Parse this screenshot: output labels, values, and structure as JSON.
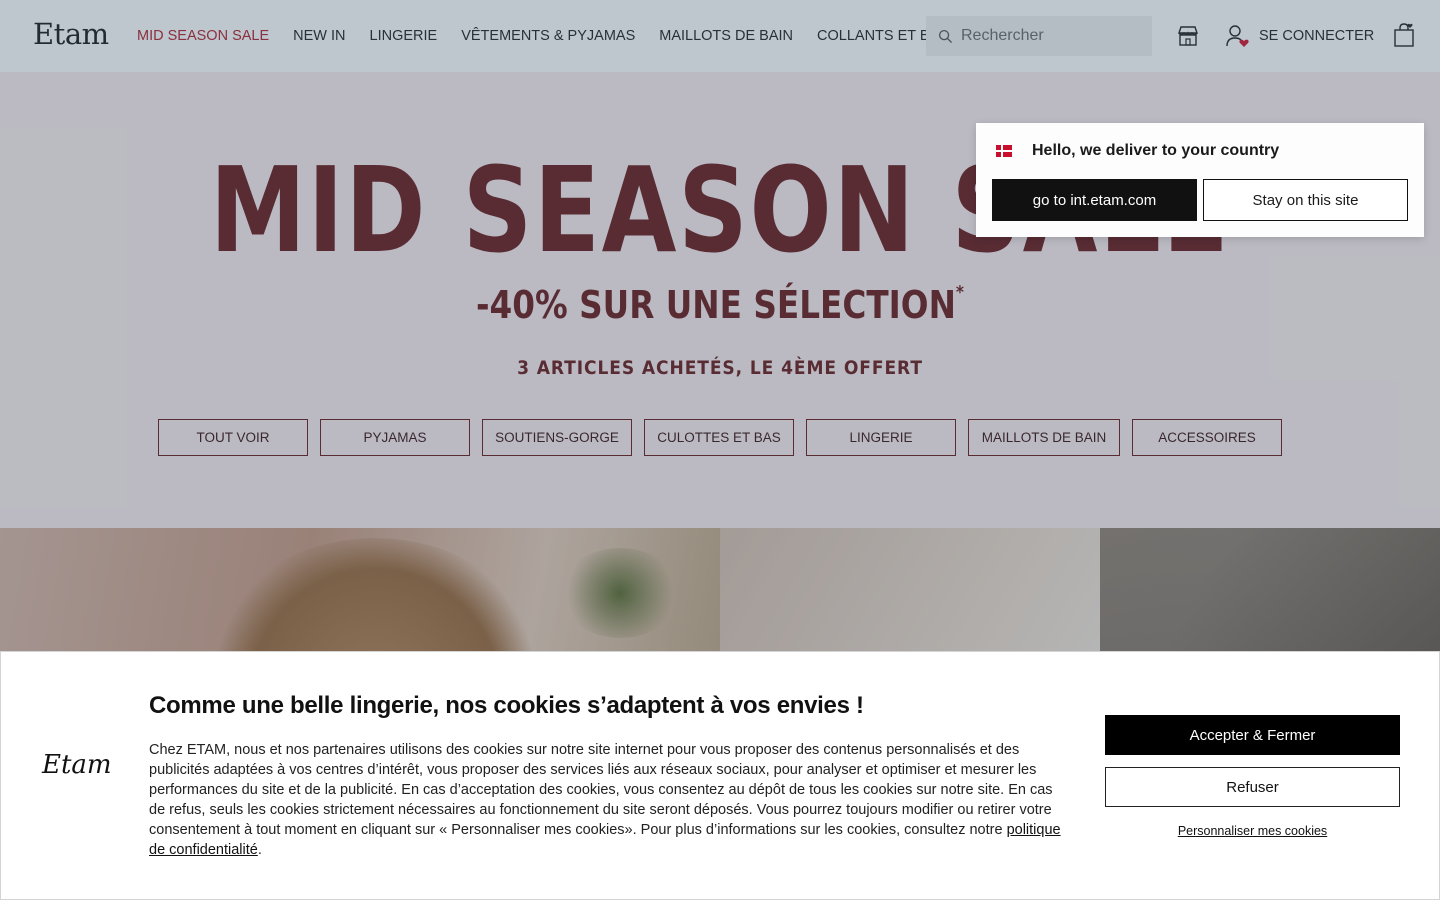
{
  "header": {
    "logo": "Etam",
    "nav": [
      {
        "label": "MID SEASON SALE",
        "highlight": true
      },
      {
        "label": "NEW IN"
      },
      {
        "label": "LINGERIE"
      },
      {
        "label": "VÊTEMENTS & PYJAMAS"
      },
      {
        "label": "MAILLOTS DE BAIN"
      },
      {
        "label": "COLLANTS ET BAS"
      }
    ],
    "search_placeholder": "Rechercher",
    "login_label": "SE CONNECTER"
  },
  "hero": {
    "title": "MID SEASON SALE",
    "subtitle": "-40% SUR UNE SÉLECTION",
    "subtitle_mark": "*",
    "offer": "3 ARTICLES ACHETÉS, LE 4ÈME OFFERT",
    "categories": [
      "TOUT VOIR",
      "PYJAMAS",
      "SOUTIENS-GORGE",
      "CULOTTES ET BAS",
      "LINGERIE",
      "MAILLOTS DE BAIN",
      "ACCESSOIRES"
    ]
  },
  "country_popup": {
    "title": "Hello, we deliver to your country",
    "go_button": "go to int.etam.com",
    "stay_button": "Stay on this site"
  },
  "cookie": {
    "logo": "Etam",
    "title": "Comme une belle lingerie, nos cookies s’adaptent à vos envies !",
    "text": "Chez ETAM, nous et nos partenaires utilisons des cookies sur notre site internet pour vous proposer des contenus personnalisés et des publicités adaptées à vos centres d’intérêt, vous proposer des services liés aux réseaux sociaux, pour analyser et optimiser et mesurer les performances du site et de la publicité. En cas d’acceptation des cookies, vous consentez au dépôt de tous les cookies sur notre site. En cas de refus, seuls les cookies strictement nécessaires au fonctionnement du site seront déposés. Vous pourrez toujours modifier ou retirer votre consentement à tout moment en cliquant sur « Personnaliser mes cookies». Pour plus d’informations sur les cookies, consultez notre",
    "policy_link": "politique de confidentialité",
    "period": ".",
    "accept_button": "Accepter & Fermer",
    "refuse_button": "Refuser",
    "customize_link": "Personnaliser mes cookies"
  },
  "colors": {
    "sale_red": "#b4222b",
    "hero_bg": "#fbeeee",
    "hero_text": "#6b1c1c"
  }
}
